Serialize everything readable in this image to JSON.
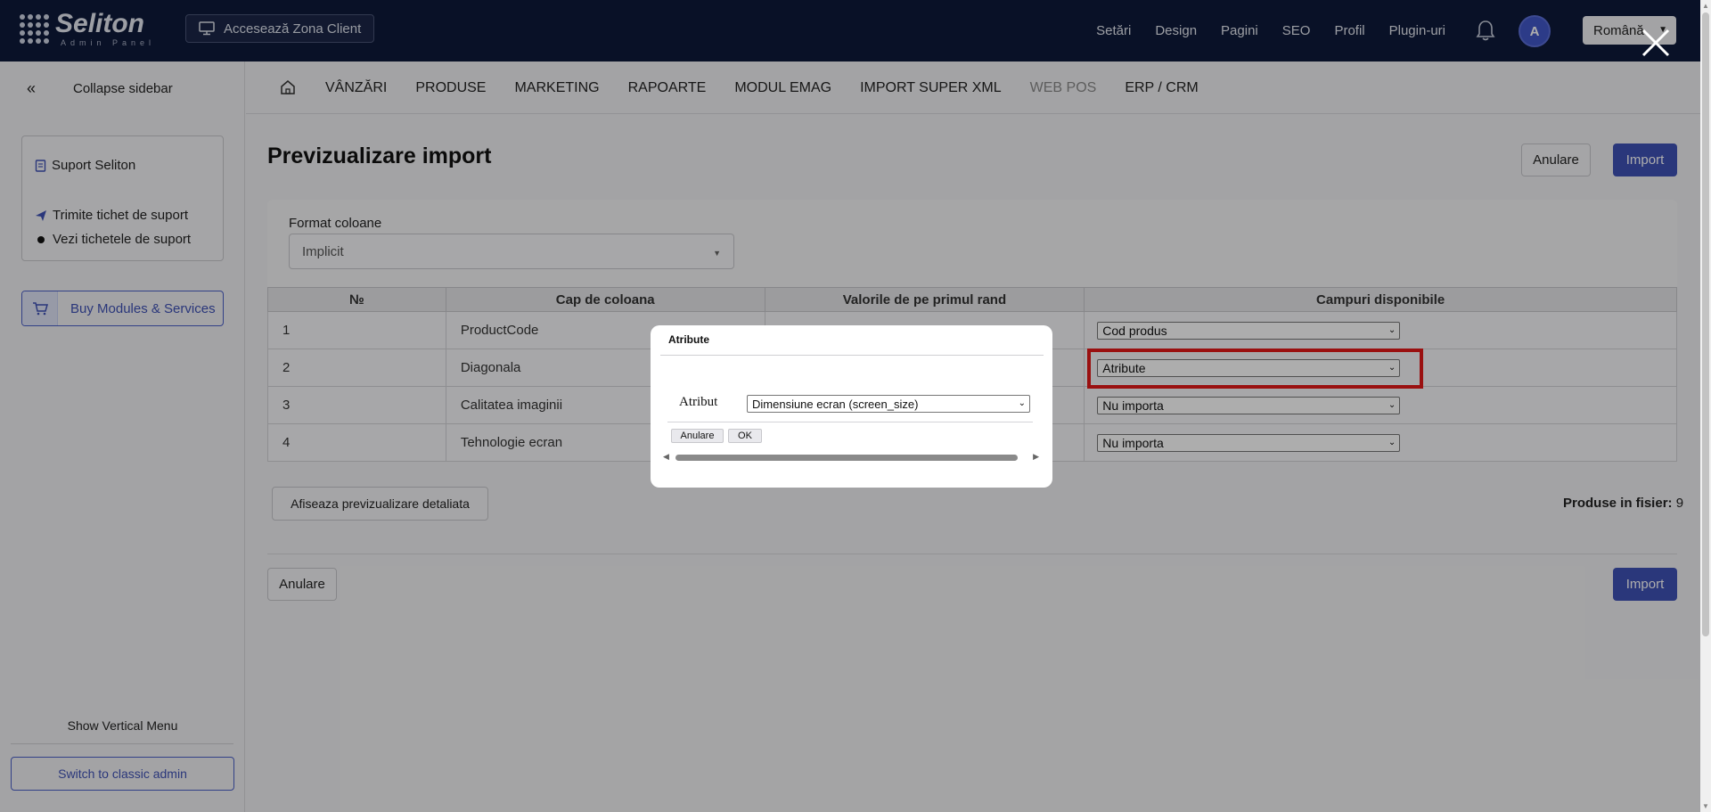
{
  "header": {
    "logo_name": "Seliton",
    "logo_sub": "Admin Panel",
    "client_button": "Accesează Zona Client",
    "nav": [
      "Setări",
      "Design",
      "Pagini",
      "SEO",
      "Profil",
      "Plugin-uri"
    ],
    "avatar_letter": "A",
    "language": "Română"
  },
  "sidebar": {
    "collapse_label": "Collapse sidebar",
    "support_title": "Suport Seliton",
    "support_items": [
      "Trimite tichet de suport",
      "Vezi tichetele de suport"
    ],
    "buy_label": "Buy Modules & Services",
    "show_vertical_menu": "Show Vertical Menu",
    "switch_classic": "Switch to classic admin"
  },
  "menu": {
    "items": [
      "VÂNZĂRI",
      "PRODUSE",
      "MARKETING",
      "RAPOARTE",
      "MODUL EMAG",
      "IMPORT SUPER XML",
      "WEB POS",
      "ERP / CRM"
    ]
  },
  "page": {
    "title": "Previzualizare import",
    "cancel_label": "Anulare",
    "import_label": "Import",
    "format_label": "Format coloane",
    "format_value": "Implicit",
    "table": {
      "headers": [
        "№",
        "Cap de coloana",
        "Valorile de pe primul rand",
        "Campuri disponibile"
      ],
      "rows": [
        {
          "num": "1",
          "column": "ProductCode",
          "value": "",
          "field": "Cod produs"
        },
        {
          "num": "2",
          "column": "Diagonala",
          "value": "",
          "field": "Atribute"
        },
        {
          "num": "3",
          "column": "Calitatea imaginii",
          "value": "",
          "field": "Nu importa"
        },
        {
          "num": "4",
          "column": "Tehnologie ecran",
          "value": "",
          "field": "Nu importa"
        }
      ]
    },
    "detail_button": "Afiseaza previzualizare detaliata",
    "products_label": "Produse in fisier:",
    "products_count": "9"
  },
  "modal": {
    "title": "Atribute",
    "field_label": "Atribut",
    "field_value": "Dimensiune ecran (screen_size)",
    "cancel_label": "Anulare",
    "ok_label": "OK"
  },
  "colors": {
    "topbar": "#0e1a3a",
    "primary": "#3f51b5",
    "highlight": "#e31818"
  }
}
